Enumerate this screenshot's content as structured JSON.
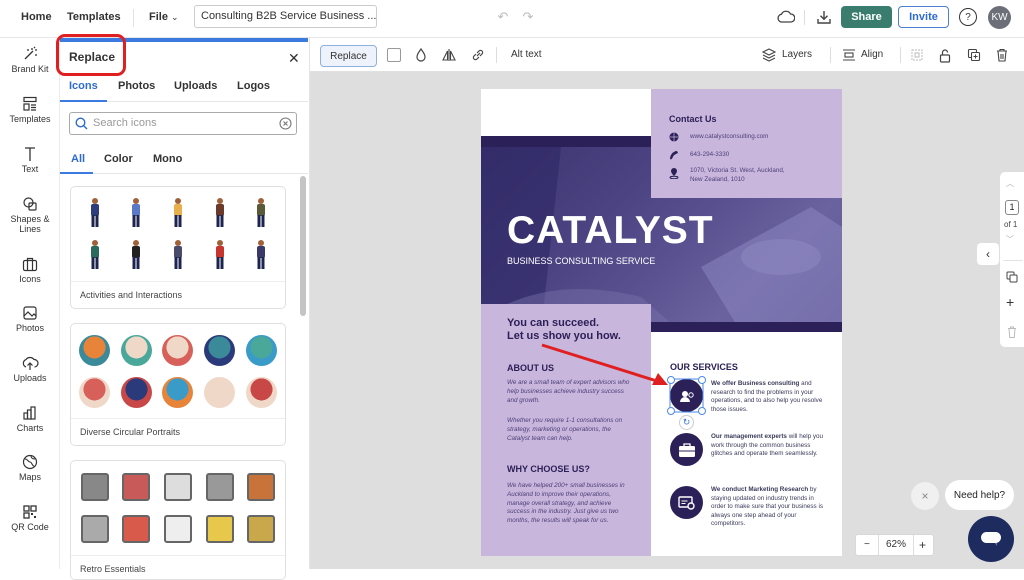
{
  "topbar": {
    "home": "Home",
    "templates": "Templates",
    "file": "File",
    "document_title": "Consulting B2B Service Business ...",
    "share": "Share",
    "invite": "Invite",
    "help": "?",
    "avatar_initials": "KW"
  },
  "leftrail": {
    "items": [
      {
        "label": "Brand Kit",
        "icon": "magic-wand-icon"
      },
      {
        "label": "Templates",
        "icon": "templates-icon"
      },
      {
        "label": "Text",
        "icon": "text-icon"
      },
      {
        "label": "Shapes &\nLines",
        "icon": "shapes-icon"
      },
      {
        "label": "Icons",
        "icon": "briefcase-icon"
      },
      {
        "label": "Photos",
        "icon": "image-icon"
      },
      {
        "label": "Uploads",
        "icon": "cloud-upload-icon"
      },
      {
        "label": "Charts",
        "icon": "bar-chart-icon"
      },
      {
        "label": "Maps",
        "icon": "globe-icon"
      },
      {
        "label": "QR Code",
        "icon": "qr-code-icon"
      }
    ]
  },
  "panel": {
    "title": "Replace",
    "tabs": [
      "Icons",
      "Photos",
      "Uploads",
      "Logos"
    ],
    "active_tab": "Icons",
    "search_placeholder": "Search icons",
    "subtabs": [
      "All",
      "Color",
      "Mono"
    ],
    "active_subtab": "All",
    "collections": [
      {
        "label": "Activities and Interactions"
      },
      {
        "label": "Diverse Circular Portraits"
      },
      {
        "label": "Retro Essentials"
      }
    ]
  },
  "toolbar": {
    "replace": "Replace",
    "alt_text": "Alt text",
    "layers": "Layers",
    "align": "Align"
  },
  "document": {
    "contact_title": "Contact Us",
    "website": "www.catalystconsulting.com",
    "phone": "643-294-3330",
    "address_line1": "1070, Victoria St. West, Auckland,",
    "address_line2": "New Zealand, 1010",
    "brand": "CATALYST",
    "tagline": "BUSINESS CONSULTING SERVICE",
    "slogan_line1": "You can succeed.",
    "slogan_line2": "Let us show you how.",
    "about_title": "ABOUT US",
    "about_p1": "We are a small team of expert advisors who help businesses achieve industry success and growth.",
    "about_p2": "Whether you require 1-1 consultations on strategy, marketing or operations, the Catalyst team can help.",
    "why_title": "WHY CHOOSE US?",
    "why_p": "We have helped 200+ small businesses in Auckland to improve their operations, manage overall strategy, and achieve success in the industry. Just give us two months, the results will speak for us.",
    "services_title": "OUR SERVICES",
    "services": [
      {
        "bold": "We offer Business consulting",
        "rest": " and research to find the problems in your operations, and to also help you resolve those issues."
      },
      {
        "bold": "Our management experts",
        "rest": " will help you work through the common business glitches and operate them seamlessly."
      },
      {
        "bold": "We conduct Marketing Research",
        "rest": " by staying updated on industry trends in order to make sure that your business is always one step ahead of your competitors."
      }
    ]
  },
  "pager": {
    "current": "1",
    "of": "of 1"
  },
  "zoom": {
    "minus": "−",
    "value": "62%",
    "plus": "+"
  },
  "help": {
    "bubble": "Need help?",
    "close": "×"
  },
  "colors": {
    "accent_blue": "#3b7ae0",
    "share_green": "#3a7d6e",
    "doc_navy": "#2b2057",
    "doc_lavender": "#c9b6dc",
    "highlight_red": "#e02020"
  }
}
